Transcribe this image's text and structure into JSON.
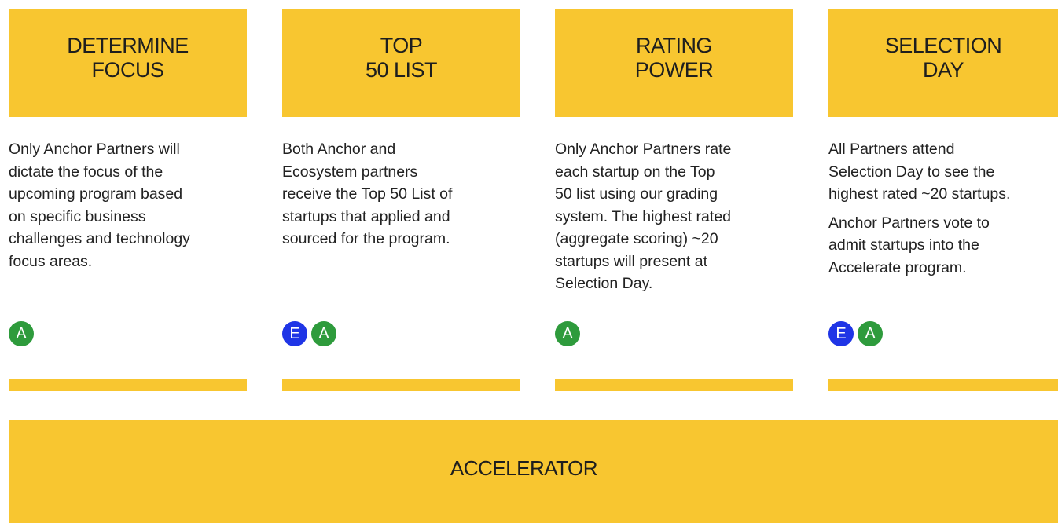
{
  "steps": [
    {
      "title_lines": [
        "DETERMINE",
        "FOCUS"
      ],
      "paragraphs": [
        [
          "Only Anchor Partners will",
          "dictate the focus of the",
          "upcoming program based",
          "on specific business",
          "challenges and technology",
          "focus areas."
        ]
      ],
      "badges": [
        "A"
      ]
    },
    {
      "title_lines": [
        "TOP",
        "50 LIST"
      ],
      "paragraphs": [
        [
          "Both Anchor and",
          "Ecosystem partners",
          "receive the Top 50 List of",
          "startups that applied and",
          "sourced for the program."
        ]
      ],
      "badges": [
        "E",
        "A"
      ]
    },
    {
      "title_lines": [
        "RATING",
        "POWER"
      ],
      "paragraphs": [
        [
          "Only Anchor Partners rate",
          "each startup on the Top",
          "50 list using our grading",
          "system. The highest rated",
          "(aggregate scoring) ~20",
          "startups will present at",
          "Selection Day."
        ]
      ],
      "badges": [
        "A"
      ]
    },
    {
      "title_lines": [
        "SELECTION",
        "DAY"
      ],
      "paragraphs": [
        [
          "All Partners attend",
          "Selection Day to see the",
          "highest rated ~20 startups."
        ],
        [
          "Anchor Partners vote to",
          "admit startups into the",
          "Accelerate program."
        ]
      ],
      "badges": [
        "E",
        "A"
      ]
    }
  ],
  "accelerator": {
    "label": "ACCELERATOR"
  },
  "colors": {
    "panel": "#f8c630",
    "badge_A": "#2e9b3c",
    "badge_E": "#1f35e6"
  }
}
